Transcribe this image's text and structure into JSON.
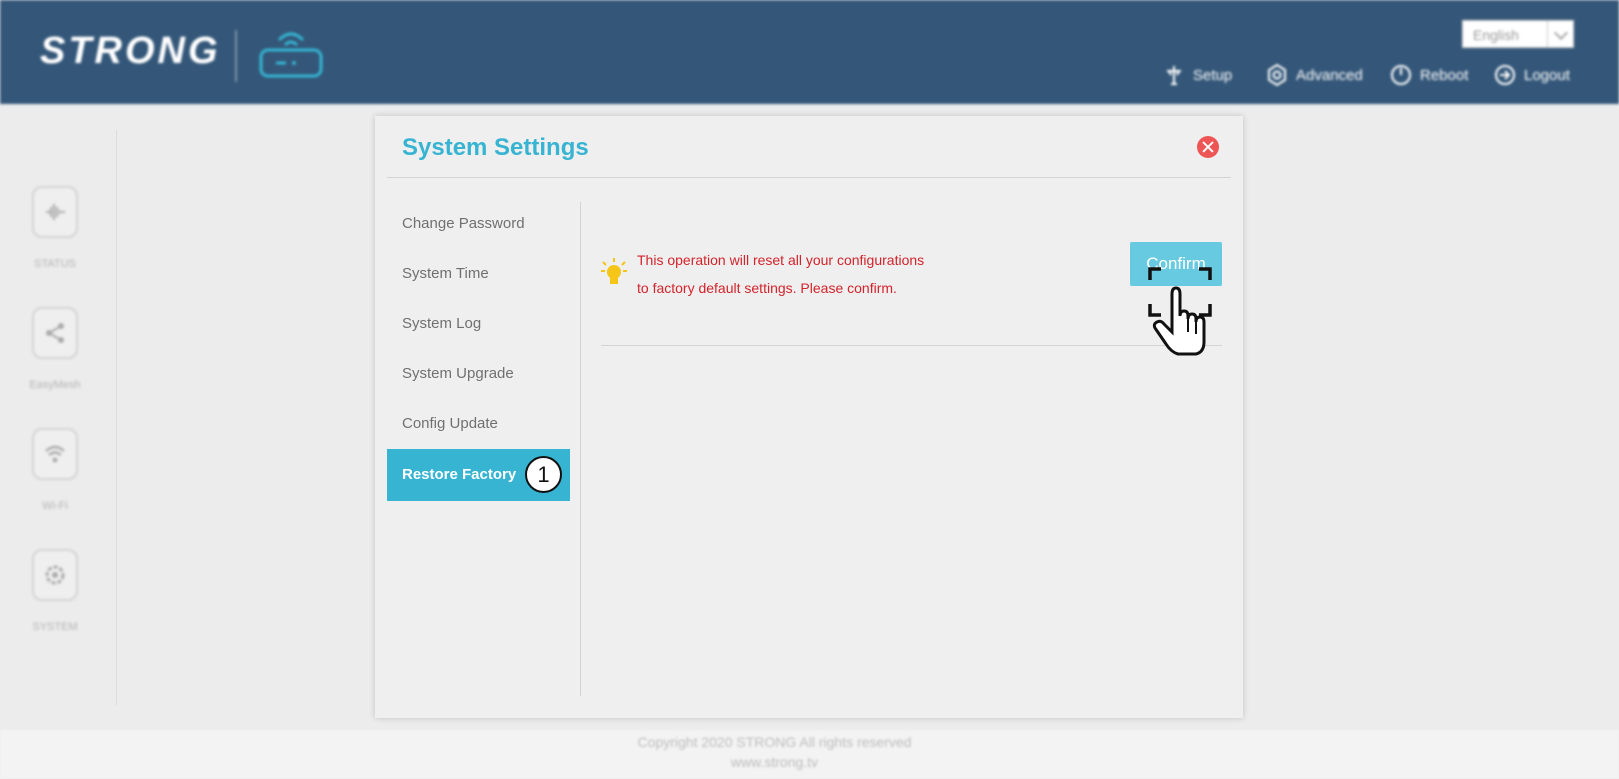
{
  "header": {
    "logo_text": "STRONG",
    "language": "English",
    "nav": {
      "setup": "Setup",
      "advanced": "Advanced",
      "reboot": "Reboot",
      "logout": "Logout"
    }
  },
  "sidebar": {
    "items": [
      {
        "label": "STATUS",
        "icon": "status-icon"
      },
      {
        "label": "EasyMesh",
        "icon": "share-icon"
      },
      {
        "label": "Wi-Fi",
        "icon": "wifi-icon"
      },
      {
        "label": "SYSTEM",
        "icon": "gear-icon"
      }
    ]
  },
  "modal": {
    "title": "System Settings",
    "menu": [
      "Change Password",
      "System Time",
      "System Log",
      "System Upgrade",
      "Config Update",
      "Restore Factory"
    ],
    "active_menu": "Restore Factory",
    "step_badge": "1",
    "warning_line1": "This operation will reset all your configurations",
    "warning_line2": "to factory default settings. Please confirm.",
    "confirm_label": "Confirm"
  },
  "footer": {
    "copyright": "Copyright 2020 STRONG All rights reserved",
    "website": "www.strong.tv"
  },
  "colors": {
    "header_bg": "#345779",
    "accent": "#36b4d2",
    "warning_text": "#d3232b",
    "close": "#ee5555"
  }
}
